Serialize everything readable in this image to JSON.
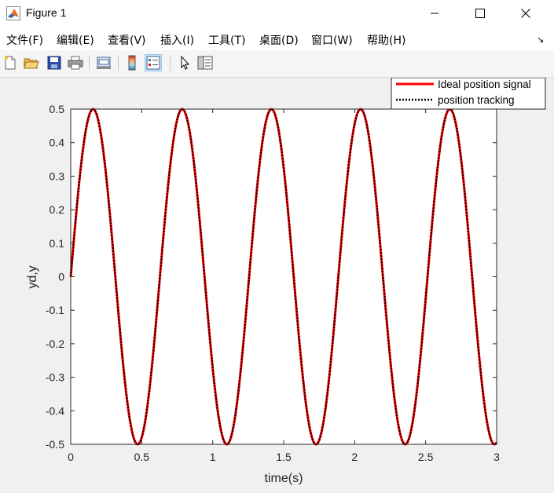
{
  "window": {
    "title": "Figure 1",
    "icon": "matlab-icon",
    "controls": [
      "minimize-icon",
      "maximize-icon",
      "close-icon"
    ]
  },
  "menu": {
    "items": [
      "文件(F)",
      "编辑(E)",
      "查看(V)",
      "插入(I)",
      "工具(T)",
      "桌面(D)",
      "窗口(W)",
      "帮助(H)"
    ],
    "overflow_icon": "chevron-down-right-icon"
  },
  "toolbar": {
    "buttons": [
      "new-figure-icon",
      "open-file-icon",
      "save-icon",
      "print-icon",
      "link-plot-icon",
      "insert-colorbar-icon",
      "insert-legend-icon",
      "edit-plot-arrow-icon",
      "property-editor-icon"
    ],
    "pressed": "insert-legend-icon"
  },
  "chart_data": {
    "type": "line",
    "title": "",
    "xlabel": "time(s)",
    "ylabel": "yd,y",
    "xlim": [
      0,
      3
    ],
    "ylim": [
      -0.5,
      0.5
    ],
    "xticks": [
      "0",
      "0.5",
      "1",
      "1.5",
      "2",
      "2.5",
      "3"
    ],
    "yticks": [
      "0.5",
      "0.4",
      "0.3",
      "0.2",
      "0.1",
      "0",
      "-0.1",
      "-0.2",
      "-0.3",
      "-0.4",
      "-0.5"
    ],
    "xtick_values": [
      0,
      0.5,
      1,
      1.5,
      2,
      2.5,
      3
    ],
    "ytick_values": [
      0.5,
      0.4,
      0.3,
      0.2,
      0.1,
      0,
      -0.1,
      -0.2,
      -0.3,
      -0.4,
      -0.5
    ],
    "function": "y = 0.5*sin(10*t)",
    "amplitude": 0.5,
    "angular_frequency": 10,
    "grid": false,
    "legend_position": "top-right (outside axes)",
    "series": [
      {
        "name": "Ideal position signal",
        "color": "#ff0000",
        "style": "solid"
      },
      {
        "name": "position tracking",
        "color": "#000000",
        "style": "dotted"
      }
    ]
  }
}
